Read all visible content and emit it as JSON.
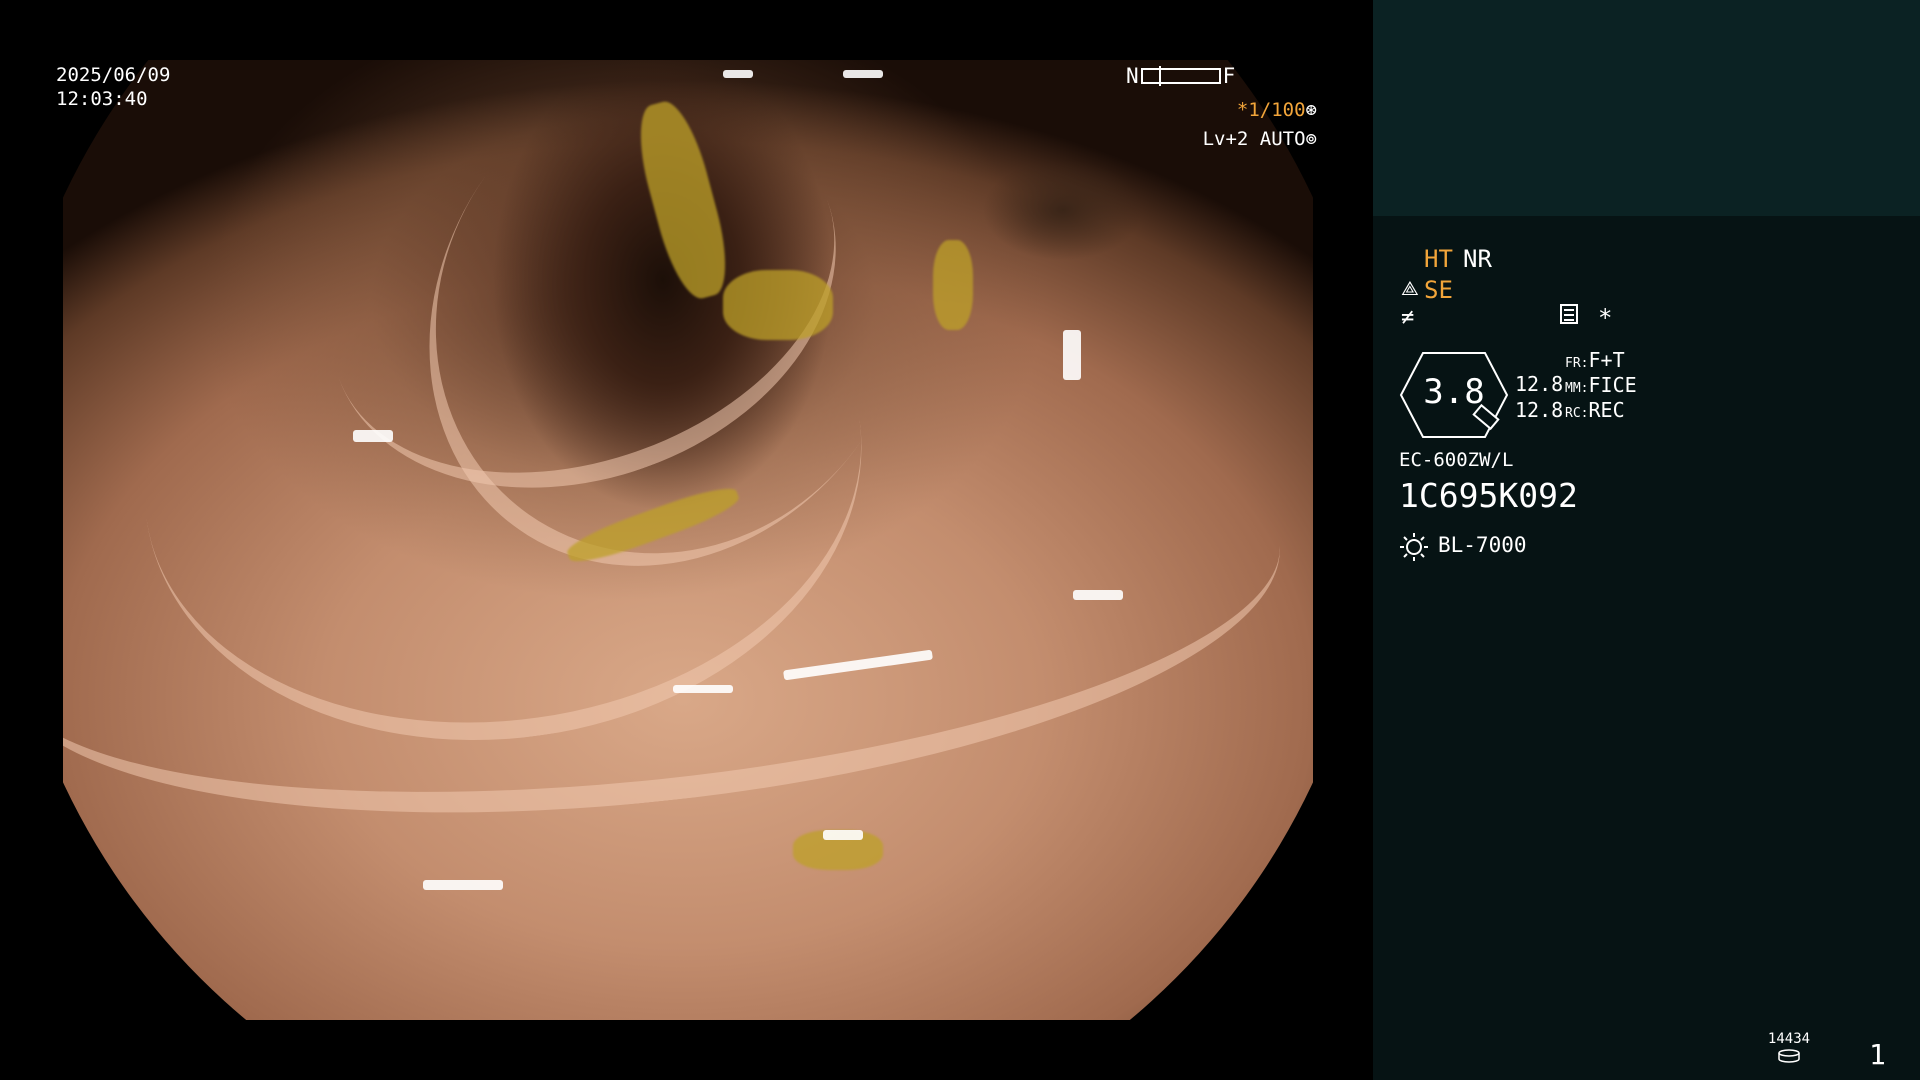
{
  "overlay": {
    "date": "2025/06/09",
    "time": "12:03:40",
    "nf_near": "N",
    "nf_far": "F",
    "shutter": "*1/100",
    "shutter_icon": "iris-icon",
    "level_auto": "Lv+2 AUTO",
    "auto_icon": "auto-ring-icon"
  },
  "panel": {
    "ht": "HT",
    "nr": "NR",
    "se": "SE",
    "zoom": "3.8",
    "val1": "12.8",
    "val2": "12.8",
    "fr_label": "FR:",
    "fr_value": "F+T",
    "mm_label": "MM:",
    "mm_value": "FICE",
    "rc_label": "RC:",
    "rc_value": "REC",
    "star": "*",
    "scope_model": "EC-600ZW/L",
    "serial": "1C695K092",
    "lamp": "BL-7000",
    "counter": "14434",
    "page": "1"
  },
  "colors": {
    "accent": "#f2a53a",
    "panel_bg": "#061314",
    "panel_top_bg": "#0b2223"
  }
}
